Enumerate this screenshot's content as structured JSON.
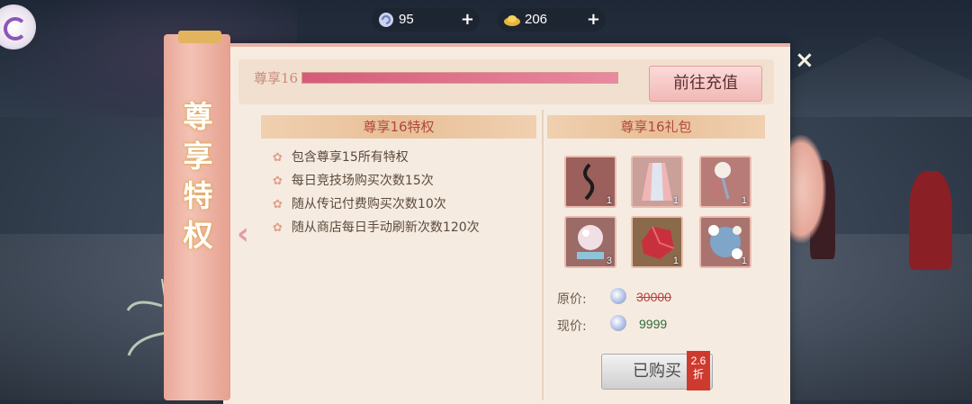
{
  "currencies": [
    {
      "icon": "swirl-gem-icon",
      "value": "95",
      "plus": "+"
    },
    {
      "icon": "gold-ingot-icon",
      "value": "206",
      "plus": "+"
    }
  ],
  "scroll": {
    "label_chars": [
      "尊",
      "享",
      "特",
      "权"
    ]
  },
  "progress": {
    "level_tag": "尊享16",
    "fill_fraction": 1.0,
    "recharge_label": "前往充值"
  },
  "privileges": {
    "header": "尊享16特权",
    "items": [
      "包含尊享15所有特权",
      "每日竞技场购买次数15次",
      "随从传记付费购买次数10次",
      "随从商店每日手动刷新次数120次"
    ]
  },
  "gift": {
    "header": "尊享16礼包",
    "items": [
      {
        "icon": "ink-pendant-icon",
        "count": "1"
      },
      {
        "icon": "pink-robe-icon",
        "count": "1"
      },
      {
        "icon": "moon-tassel-icon",
        "count": "1"
      },
      {
        "icon": "crystal-ball-icon",
        "count": "3"
      },
      {
        "icon": "red-gem-icon",
        "count": "1"
      },
      {
        "icon": "flower-mirror-icon",
        "count": "1"
      }
    ],
    "original_label": "原价:",
    "original_price": "30000",
    "current_label": "现价:",
    "current_price": "9999",
    "bought_label": "已购买",
    "discount_top": "2.6",
    "discount_bottom": "折"
  },
  "close": "×"
}
